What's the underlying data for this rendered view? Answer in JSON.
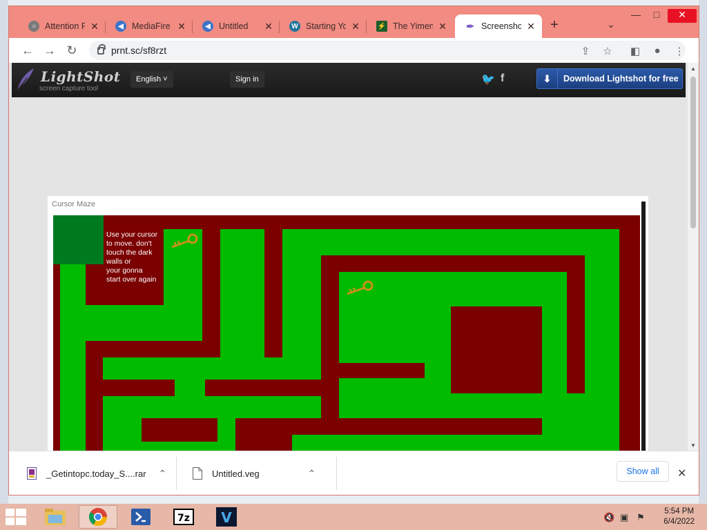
{
  "tabs": [
    {
      "title": "Attention Re",
      "favicon": "globe-icon"
    },
    {
      "title": "MediaFire -",
      "favicon": "mediafire-icon"
    },
    {
      "title": "Untitled",
      "favicon": "mediafire-icon"
    },
    {
      "title": "Starting You",
      "favicon": "wordpress-icon"
    },
    {
      "title": "The Yimen",
      "favicon": "yimen-icon"
    },
    {
      "title": "Screenshot",
      "favicon": "lightshot-icon",
      "active": true
    }
  ],
  "address_bar": {
    "url": "prnt.sc/sf8rzt"
  },
  "lightshot": {
    "brand": "LightShot",
    "tagline": "screen capture tool",
    "language": "English",
    "sign_in": "Sign in",
    "download": "Download Lightshot for free"
  },
  "screenshot": {
    "window_title": "Cursor Maze",
    "instructions": [
      "Use your cursor",
      "to move. don't",
      "touch the dark",
      "walls or",
      "your gonna",
      "start over again"
    ]
  },
  "downloads": [
    {
      "name": "_Getintopc.today_S....rar"
    },
    {
      "name": "Untitled.veg"
    }
  ],
  "downloads_show_all": "Show all",
  "taskbar": {
    "apps": [
      "file-explorer",
      "chrome",
      "powershell",
      "7zip",
      "vegas"
    ],
    "time": "5:54 PM",
    "date": "6/4/2022"
  },
  "colors": {
    "tabstrip": "#f28b82",
    "maze_wall": "#7b0000",
    "maze_path": "#00bb00",
    "maze_start": "#007a1f",
    "download_button": "#1c3f80",
    "taskbar": "#e7b7a7"
  }
}
